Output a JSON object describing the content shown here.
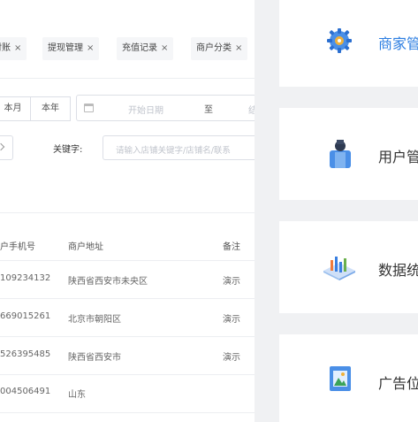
{
  "tags": [
    {
      "label": "对账"
    },
    {
      "label": "提现管理"
    },
    {
      "label": "充值记录"
    },
    {
      "label": "商户分类"
    }
  ],
  "tag_close_glyph": "×",
  "filters": {
    "month_btn": "本月",
    "year_btn": "本年",
    "date_start_placeholder": "开始日期",
    "date_sep": "至",
    "date_end_placeholder": "结",
    "keyword_label": "关键字:",
    "keyword_placeholder": "请输入店铺关键字/店铺名/联系"
  },
  "table": {
    "headers": [
      "户手机号",
      "商户地址",
      "备注"
    ],
    "rows": [
      {
        "phone": "109234132",
        "address": "陕西省西安市未央区",
        "remark": "演示"
      },
      {
        "phone": "669015261",
        "address": "北京市朝阳区",
        "remark": "演示"
      },
      {
        "phone": "526395485",
        "address": "陕西省西安市",
        "remark": "演示"
      },
      {
        "phone": "004506491",
        "address": "山东",
        "remark": ""
      }
    ]
  },
  "cards": [
    {
      "label": "商家管",
      "icon": "gear-icon",
      "color": "#2b7de1"
    },
    {
      "label": "用户管",
      "icon": "user-icon",
      "color": "#333333"
    },
    {
      "label": "数据统",
      "icon": "chart-icon",
      "color": "#333333"
    },
    {
      "label": "广告位",
      "icon": "picture-icon",
      "color": "#333333"
    }
  ]
}
